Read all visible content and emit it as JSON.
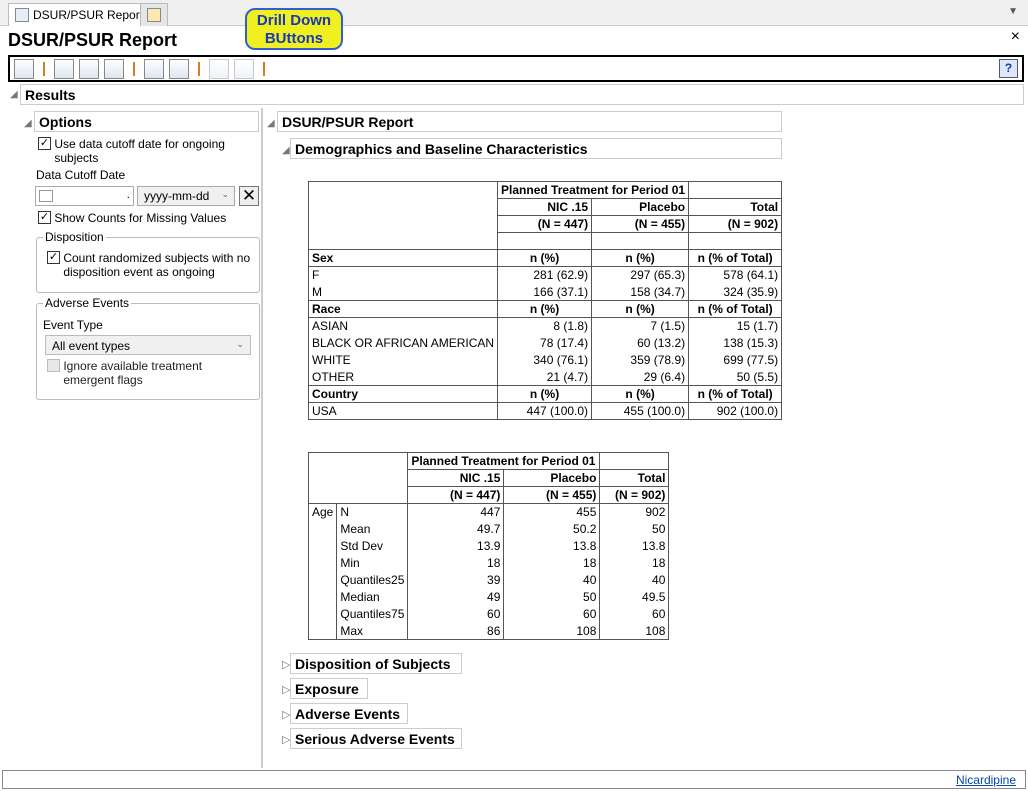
{
  "tabs": [
    {
      "label": "DSUR/PSUR Report"
    },
    {
      "label": ""
    }
  ],
  "title": "DSUR/PSUR Report",
  "callout": "Drill Down BUttons",
  "help": "?",
  "close": "×",
  "results": "Results",
  "options": {
    "header": "Options",
    "use_cutoff": "Use data cutoff date for ongoing subjects",
    "cutoff_label": "Data Cutoff Date",
    "cutoff_value": ".",
    "date_format": "yyyy-mm-dd",
    "show_missing": "Show Counts for Missing Values",
    "disposition": "Disposition",
    "count_randomized": "Count randomized subjects with no disposition event as ongoing",
    "adverse_events": "Adverse Events",
    "event_type_label": "Event Type",
    "event_type": "All event types",
    "ignore_flags": "Ignore available treatment emergent flags"
  },
  "report": {
    "header": "DSUR/PSUR Report",
    "demographics": "Demographics and Baseline Characteristics",
    "collapsed": [
      "Disposition of Subjects",
      "Exposure",
      "Adverse Events",
      "Serious Adverse Events"
    ]
  },
  "table1": {
    "group_header": "Planned Treatment for Period 01",
    "columns": [
      "NIC .15",
      "Placebo",
      "Total"
    ],
    "ns": [
      "(N = 447)",
      "(N = 455)",
      "(N = 902)"
    ],
    "sections": [
      {
        "name": "Sex",
        "stats": [
          "n (%)",
          "n (%)",
          "n (% of Total)"
        ],
        "rows": [
          [
            "F",
            "281 (62.9)",
            "297 (65.3)",
            "578 (64.1)"
          ],
          [
            "M",
            "166 (37.1)",
            "158 (34.7)",
            "324 (35.9)"
          ]
        ]
      },
      {
        "name": "Race",
        "stats": [
          "n (%)",
          "n (%)",
          "n (% of Total)"
        ],
        "rows": [
          [
            "ASIAN",
            "8 (1.8)",
            "7 (1.5)",
            "15 (1.7)"
          ],
          [
            "BLACK OR AFRICAN AMERICAN",
            "78 (17.4)",
            "60 (13.2)",
            "138 (15.3)"
          ],
          [
            "WHITE",
            "340 (76.1)",
            "359 (78.9)",
            "699 (77.5)"
          ],
          [
            "OTHER",
            "21 (4.7)",
            "29 (6.4)",
            "50 (5.5)"
          ]
        ]
      },
      {
        "name": "Country",
        "stats": [
          "n (%)",
          "n (%)",
          "n (% of Total)"
        ],
        "rows": [
          [
            "USA",
            "447 (100.0)",
            "455 (100.0)",
            "902 (100.0)"
          ]
        ]
      }
    ]
  },
  "table2": {
    "group_header": "Planned Treatment for Period 01",
    "columns": [
      "NIC .15",
      "Placebo",
      "Total"
    ],
    "ns": [
      "(N = 447)",
      "(N = 455)",
      "(N = 902)"
    ],
    "variable": "Age",
    "rows": [
      [
        "N",
        "447",
        "455",
        "902"
      ],
      [
        "Mean",
        "49.7",
        "50.2",
        "50"
      ],
      [
        "Std Dev",
        "13.9",
        "13.8",
        "13.8"
      ],
      [
        "Min",
        "18",
        "18",
        "18"
      ],
      [
        "Quantiles25",
        "39",
        "40",
        "40"
      ],
      [
        "Median",
        "49",
        "50",
        "49.5"
      ],
      [
        "Quantiles75",
        "60",
        "60",
        "60"
      ],
      [
        "Max",
        "86",
        "108",
        "108"
      ]
    ]
  },
  "status_link": "Nicardipine"
}
